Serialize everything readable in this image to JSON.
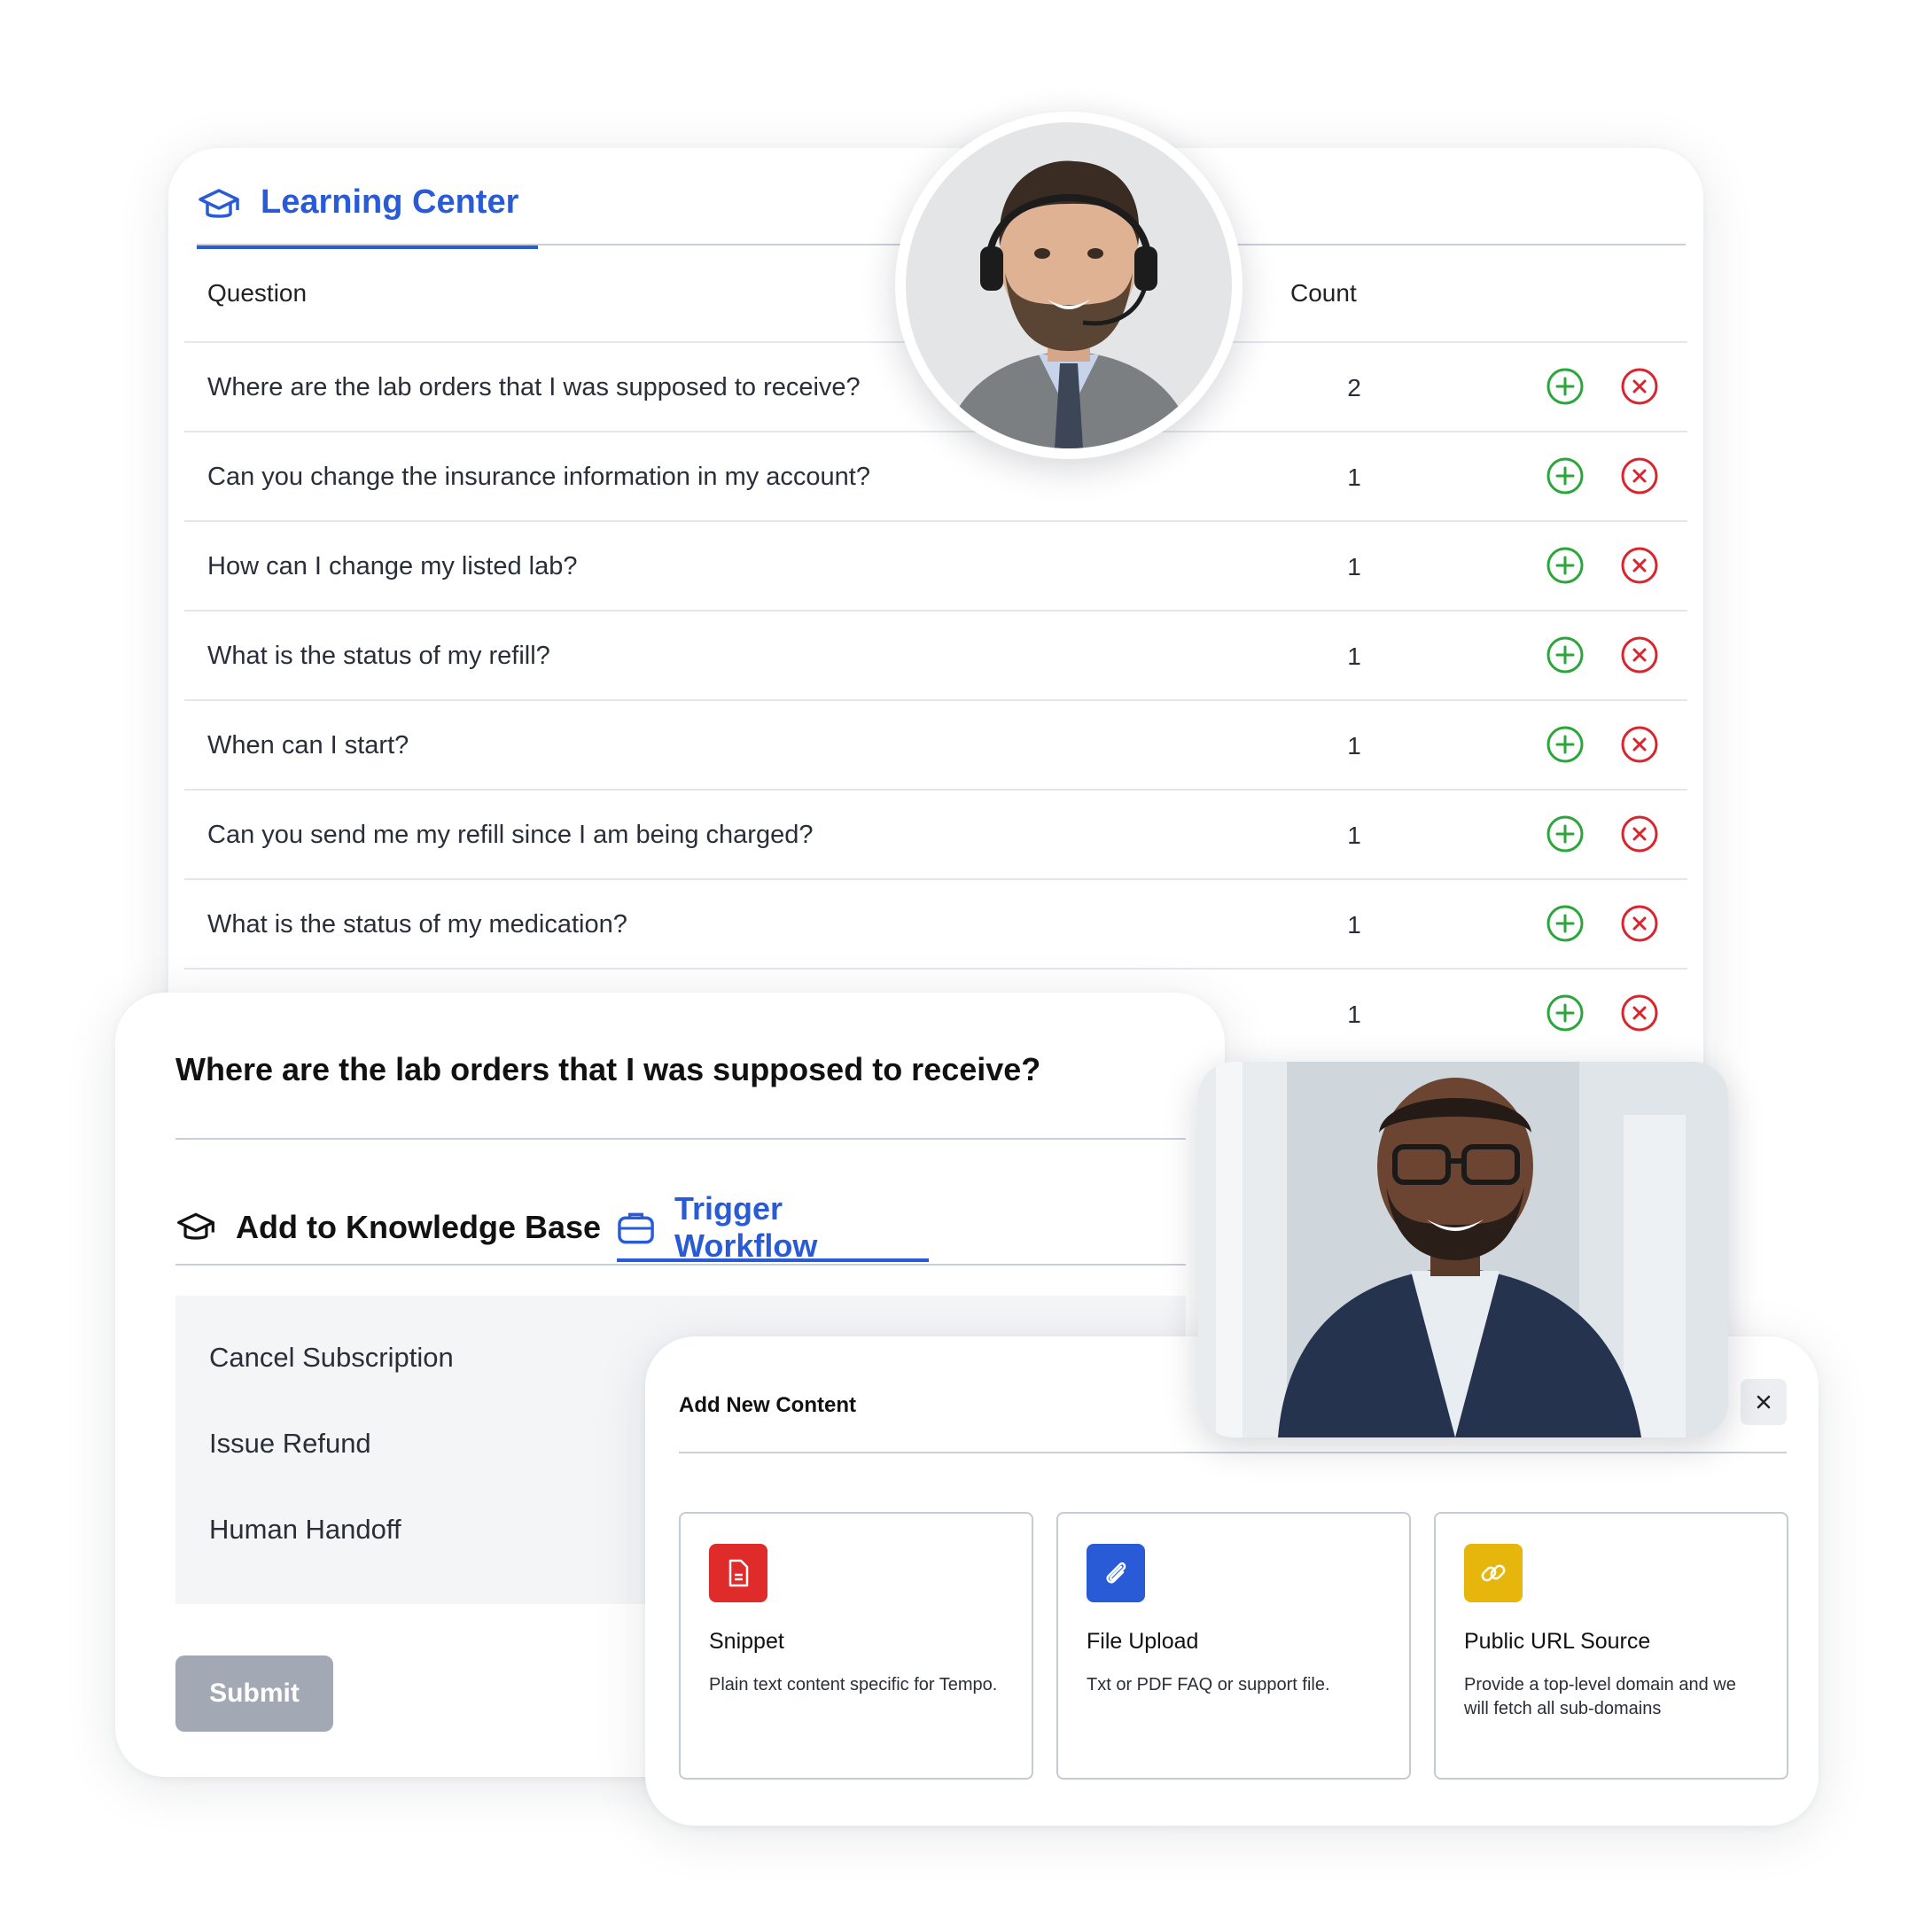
{
  "learning_center": {
    "tab_label": "Learning Center",
    "columns": {
      "question": "Question",
      "count": "Count"
    },
    "rows": [
      {
        "question": "Where are the lab orders that I was supposed to receive?",
        "count": "2"
      },
      {
        "question": "Can you change the insurance information in my account?",
        "count": "1"
      },
      {
        "question": "How can I change my listed lab?",
        "count": "1"
      },
      {
        "question": "What is the status of my refill?",
        "count": "1"
      },
      {
        "question": "When can I start?",
        "count": "1"
      },
      {
        "question": "Can you send me my refill since I am being charged?",
        "count": "1"
      },
      {
        "question": "What is the status of my medication?",
        "count": "1"
      },
      {
        "question": "",
        "count": "1"
      }
    ]
  },
  "question_detail": {
    "title": "Where are the lab orders that I was supposed to receive?",
    "tabs": {
      "knowledge": "Add to Knowledge Base",
      "workflow": "Trigger Workflow"
    },
    "workflows": [
      "Cancel Subscription",
      "Issue Refund",
      "Human Handoff"
    ],
    "submit_label": "Submit"
  },
  "new_content": {
    "title": "Add New Content",
    "options": [
      {
        "name": "Snippet",
        "desc": "Plain text content specific for Tempo.",
        "icon": "document-icon",
        "color": "#e02b2b"
      },
      {
        "name": "File Upload",
        "desc": "Txt or PDF FAQ or support file.",
        "icon": "paperclip-icon",
        "color": "#2a5bd7"
      },
      {
        "name": "Public URL Source",
        "desc": "Provide a top-level domain and we will fetch all sub-domains",
        "icon": "link-icon",
        "color": "#e6b60c"
      }
    ]
  },
  "colors": {
    "accent": "#2a5bd7",
    "add": "#2aa63a",
    "remove": "#d8262f",
    "submit_disabled": "#a3a9b4"
  }
}
